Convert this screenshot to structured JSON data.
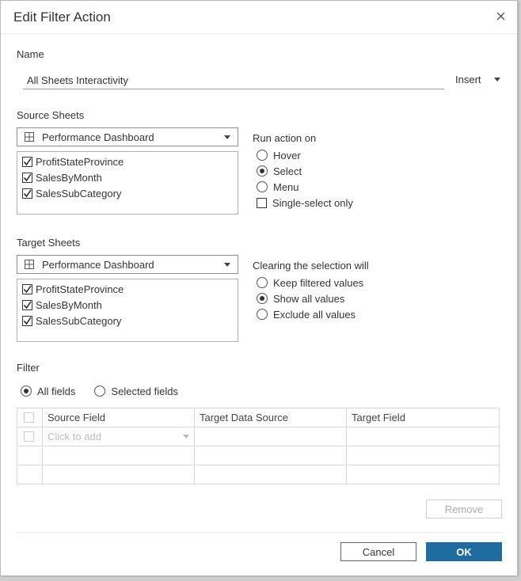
{
  "dialog": {
    "title": "Edit Filter Action"
  },
  "name_section": {
    "label": "Name",
    "value": "All Sheets Interactivity",
    "insert_label": "Insert"
  },
  "source": {
    "label": "Source Sheets",
    "dashboard": "Performance Dashboard",
    "sheets": [
      {
        "label": "ProfitStateProvince",
        "checked": true
      },
      {
        "label": "SalesByMonth",
        "checked": true
      },
      {
        "label": "SalesSubCategory",
        "checked": true
      }
    ]
  },
  "run_action": {
    "label": "Run action on",
    "options": [
      {
        "label": "Hover",
        "selected": false
      },
      {
        "label": "Select",
        "selected": true
      },
      {
        "label": "Menu",
        "selected": false
      }
    ],
    "single_select_label": "Single-select only",
    "single_select_checked": false
  },
  "target": {
    "label": "Target Sheets",
    "dashboard": "Performance Dashboard",
    "sheets": [
      {
        "label": "ProfitStateProvince",
        "checked": true
      },
      {
        "label": "SalesByMonth",
        "checked": true
      },
      {
        "label": "SalesSubCategory",
        "checked": true
      }
    ]
  },
  "clearing": {
    "label": "Clearing the selection will",
    "options": [
      {
        "label": "Keep filtered values",
        "selected": false
      },
      {
        "label": "Show all values",
        "selected": true
      },
      {
        "label": "Exclude all values",
        "selected": false
      }
    ]
  },
  "filter": {
    "label": "Filter",
    "all_fields_label": "All fields",
    "selected_fields_label": "Selected fields",
    "all_fields_selected": true,
    "columns": [
      "Source Field",
      "Target Data Source",
      "Target Field"
    ],
    "add_placeholder": "Click to add"
  },
  "buttons": {
    "remove": "Remove",
    "cancel": "Cancel",
    "ok": "OK"
  },
  "colors": {
    "accent": "#1f6ca1",
    "border": "#8f8f8f"
  }
}
